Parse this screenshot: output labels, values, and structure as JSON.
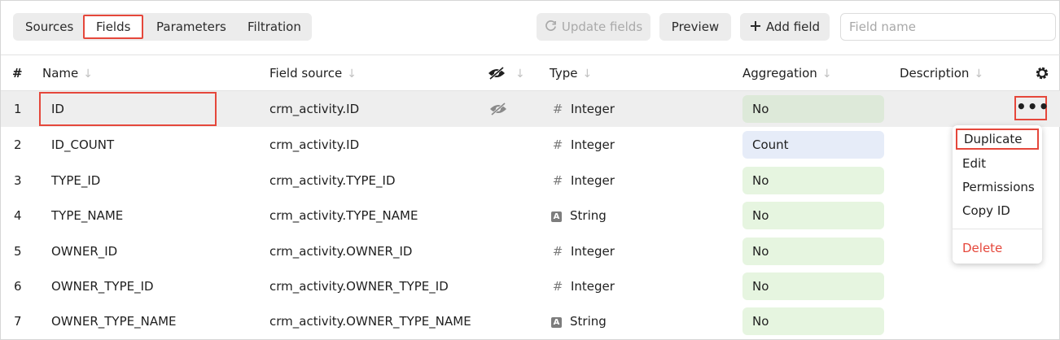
{
  "toolbar": {
    "tabs": [
      {
        "label": "Sources"
      },
      {
        "label": "Fields"
      },
      {
        "label": "Parameters"
      },
      {
        "label": "Filtration"
      }
    ],
    "update_fields_label": "Update fields",
    "preview_label": "Preview",
    "add_field_label": "Add field",
    "search_placeholder": "Field name"
  },
  "table": {
    "headers": {
      "num": "#",
      "name": "Name",
      "source": "Field source",
      "type": "Type",
      "aggregation": "Aggregation",
      "description": "Description"
    },
    "rows": [
      {
        "num": "1",
        "name": "ID",
        "source": "crm_activity.ID",
        "type": "Integer",
        "aggregation": "No"
      },
      {
        "num": "2",
        "name": "ID_COUNT",
        "source": "crm_activity.ID",
        "type": "Integer",
        "aggregation": "Count"
      },
      {
        "num": "3",
        "name": "TYPE_ID",
        "source": "crm_activity.TYPE_ID",
        "type": "Integer",
        "aggregation": "No"
      },
      {
        "num": "4",
        "name": "TYPE_NAME",
        "source": "crm_activity.TYPE_NAME",
        "type": "String",
        "aggregation": "No"
      },
      {
        "num": "5",
        "name": "OWNER_ID",
        "source": "crm_activity.OWNER_ID",
        "type": "Integer",
        "aggregation": "No"
      },
      {
        "num": "6",
        "name": "OWNER_TYPE_ID",
        "source": "crm_activity.OWNER_TYPE_ID",
        "type": "Integer",
        "aggregation": "No"
      },
      {
        "num": "7",
        "name": "OWNER_TYPE_NAME",
        "source": "crm_activity.OWNER_TYPE_NAME",
        "type": "String",
        "aggregation": "No"
      }
    ]
  },
  "context_menu": {
    "items": [
      "Duplicate",
      "Edit",
      "Permissions",
      "Copy ID"
    ],
    "delete_label": "Delete"
  },
  "icons": {
    "integer": "#",
    "string": "A",
    "more": "•••"
  },
  "colors": {
    "highlight": "#e5473b",
    "agg_no": "#e6f5e0",
    "agg_count": "#e6ecf8"
  }
}
